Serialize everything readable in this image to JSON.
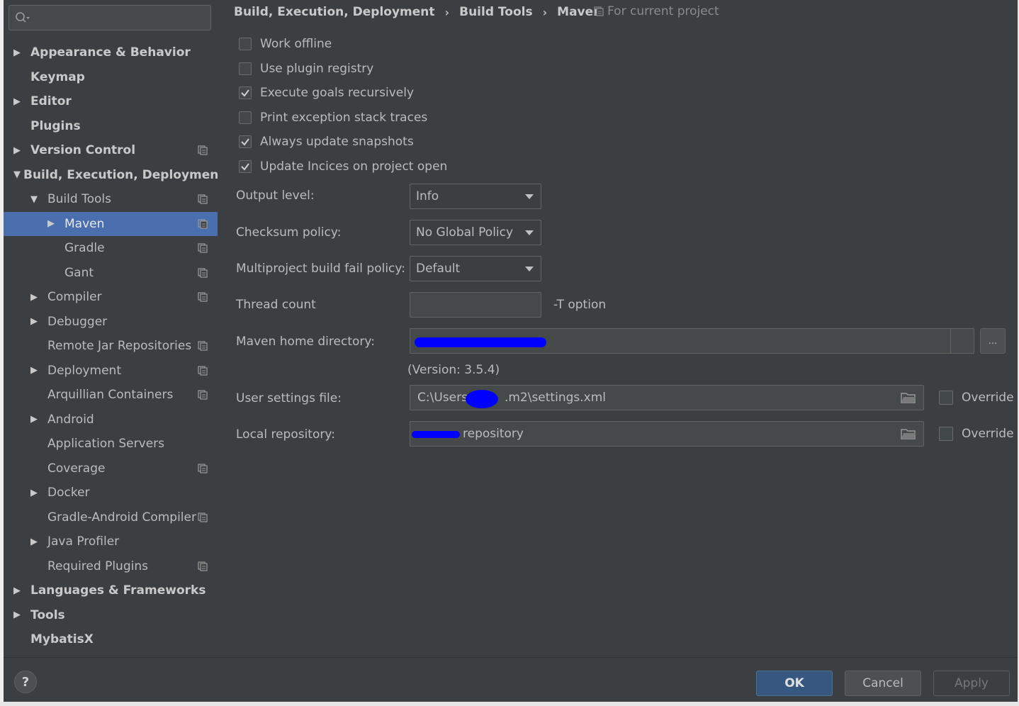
{
  "search": {
    "placeholder": ""
  },
  "tree": [
    {
      "label": "Appearance & Behavior",
      "level": 0,
      "arrow": "right",
      "bold": true,
      "proj": false
    },
    {
      "label": "Keymap",
      "level": 0,
      "arrow": "",
      "bold": true,
      "proj": false
    },
    {
      "label": "Editor",
      "level": 0,
      "arrow": "right",
      "bold": true,
      "proj": false
    },
    {
      "label": "Plugins",
      "level": 0,
      "arrow": "",
      "bold": true,
      "proj": false
    },
    {
      "label": "Version Control",
      "level": 0,
      "arrow": "right",
      "bold": true,
      "proj": true
    },
    {
      "label": "Build, Execution, Deployment",
      "level": 0,
      "arrow": "down",
      "bold": true,
      "proj": false
    },
    {
      "label": "Build Tools",
      "level": 1,
      "arrow": "down",
      "bold": false,
      "proj": true
    },
    {
      "label": "Maven",
      "level": 2,
      "arrow": "right",
      "bold": false,
      "proj": true,
      "selected": true
    },
    {
      "label": "Gradle",
      "level": 2,
      "arrow": "",
      "bold": false,
      "proj": true
    },
    {
      "label": "Gant",
      "level": 2,
      "arrow": "",
      "bold": false,
      "proj": true
    },
    {
      "label": "Compiler",
      "level": 1,
      "arrow": "right",
      "bold": false,
      "proj": true
    },
    {
      "label": "Debugger",
      "level": 1,
      "arrow": "right",
      "bold": false,
      "proj": false
    },
    {
      "label": "Remote Jar Repositories",
      "level": 1,
      "arrow": "",
      "bold": false,
      "proj": true
    },
    {
      "label": "Deployment",
      "level": 1,
      "arrow": "right",
      "bold": false,
      "proj": true
    },
    {
      "label": "Arquillian Containers",
      "level": 1,
      "arrow": "",
      "bold": false,
      "proj": true
    },
    {
      "label": "Android",
      "level": 1,
      "arrow": "right",
      "bold": false,
      "proj": false
    },
    {
      "label": "Application Servers",
      "level": 1,
      "arrow": "",
      "bold": false,
      "proj": false
    },
    {
      "label": "Coverage",
      "level": 1,
      "arrow": "",
      "bold": false,
      "proj": true
    },
    {
      "label": "Docker",
      "level": 1,
      "arrow": "right",
      "bold": false,
      "proj": false
    },
    {
      "label": "Gradle-Android Compiler",
      "level": 1,
      "arrow": "",
      "bold": false,
      "proj": true
    },
    {
      "label": "Java Profiler",
      "level": 1,
      "arrow": "right",
      "bold": false,
      "proj": false
    },
    {
      "label": "Required Plugins",
      "level": 1,
      "arrow": "",
      "bold": false,
      "proj": true
    },
    {
      "label": "Languages & Frameworks",
      "level": 0,
      "arrow": "right",
      "bold": true,
      "proj": false
    },
    {
      "label": "Tools",
      "level": 0,
      "arrow": "right",
      "bold": true,
      "proj": false
    },
    {
      "label": "MybatisX",
      "level": 0,
      "arrow": "",
      "bold": true,
      "proj": false
    }
  ],
  "breadcrumb": {
    "part1": "Build, Execution, Deployment",
    "part2": "Build Tools",
    "part3": "Maven",
    "separator": "›"
  },
  "for_project": "For current project",
  "checkboxes": [
    {
      "label": "Work offline",
      "checked": false
    },
    {
      "label": "Use plugin registry",
      "checked": false
    },
    {
      "label": "Execute goals recursively",
      "checked": true
    },
    {
      "label": "Print exception stack traces",
      "checked": false
    },
    {
      "label": "Always update snapshots",
      "checked": true
    },
    {
      "label": "Update Incices on project open",
      "checked": true
    }
  ],
  "output_level": {
    "label": "Output level:",
    "value": "Info"
  },
  "checksum_policy": {
    "label": "Checksum policy:",
    "value": "No Global Policy"
  },
  "fail_policy": {
    "label": "Multiproject build fail policy:",
    "value": "Default"
  },
  "thread_count": {
    "label": "Thread count",
    "value": "",
    "hint": "-T option"
  },
  "maven_home": {
    "label": "Maven home directory:",
    "value": "",
    "button": "...",
    "version": "(Version: 3.5.4)"
  },
  "user_settings": {
    "label": "User settings file:",
    "value_start": "C:\\Users",
    "value_end": ".m2\\settings.xml",
    "override": "Override"
  },
  "local_repo": {
    "label": "Local repository:",
    "value_end": "repository",
    "override": "Override"
  },
  "footer": {
    "help": "?",
    "ok": "OK",
    "cancel": "Cancel",
    "apply": "Apply"
  },
  "colors": {
    "selection": "#4b6eaf",
    "ok_button": "#365880",
    "redaction": "#0000ff"
  }
}
